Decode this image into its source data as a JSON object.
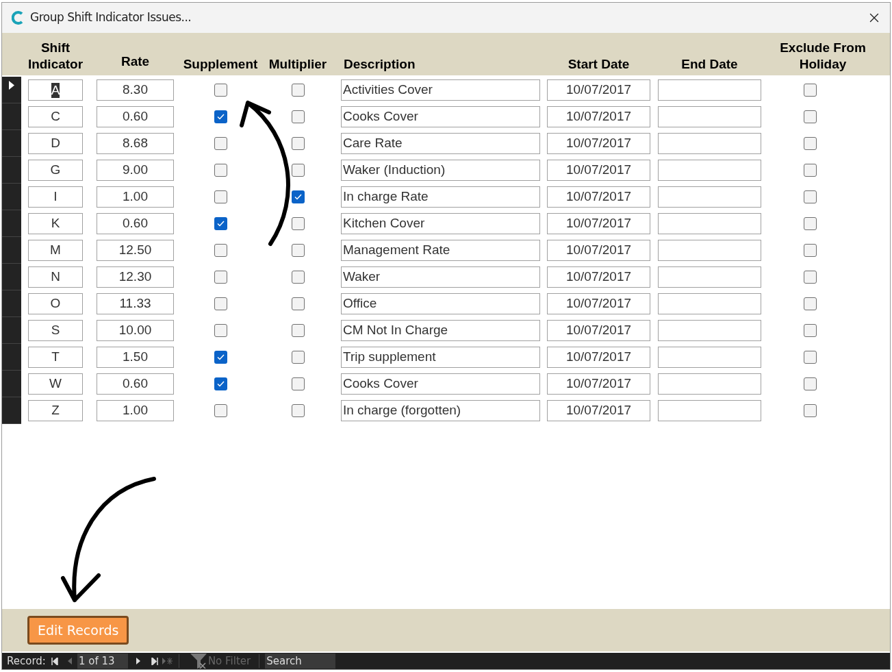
{
  "window": {
    "title": "Group Shift Indicator Issues..."
  },
  "columns": [
    "Shift Indicator",
    "Rate",
    "Supplement",
    "Multiplier",
    "Description",
    "Start Date",
    "End Date",
    "Exclude From Holiday"
  ],
  "rows": [
    {
      "shift_indicator": "A",
      "rate": "8.30",
      "supplement": false,
      "multiplier": false,
      "description": "Activities Cover",
      "start_date": "10/07/2017",
      "exclude_from_holiday": false,
      "selected": true
    },
    {
      "shift_indicator": "C",
      "rate": "0.60",
      "supplement": true,
      "multiplier": false,
      "description": "Cooks Cover",
      "start_date": "10/07/2017",
      "exclude_from_holiday": false,
      "selected": false
    },
    {
      "shift_indicator": "D",
      "rate": "8.68",
      "supplement": false,
      "multiplier": false,
      "description": "Care Rate",
      "start_date": "10/07/2017",
      "exclude_from_holiday": false,
      "selected": false
    },
    {
      "shift_indicator": "G",
      "rate": "9.00",
      "supplement": false,
      "multiplier": false,
      "description": "Waker (Induction)",
      "start_date": "10/07/2017",
      "exclude_from_holiday": false,
      "selected": false
    },
    {
      "shift_indicator": "I",
      "rate": "1.00",
      "supplement": false,
      "multiplier": true,
      "description": "In charge Rate",
      "start_date": "10/07/2017",
      "exclude_from_holiday": false,
      "selected": false
    },
    {
      "shift_indicator": "K",
      "rate": "0.60",
      "supplement": true,
      "multiplier": false,
      "description": "Kitchen Cover",
      "start_date": "10/07/2017",
      "exclude_from_holiday": false,
      "selected": false
    },
    {
      "shift_indicator": "M",
      "rate": "12.50",
      "supplement": false,
      "multiplier": false,
      "description": "Management Rate",
      "start_date": "10/07/2017",
      "exclude_from_holiday": false,
      "selected": false
    },
    {
      "shift_indicator": "N",
      "rate": "12.30",
      "supplement": false,
      "multiplier": false,
      "description": "Waker",
      "start_date": "10/07/2017",
      "exclude_from_holiday": false,
      "selected": false
    },
    {
      "shift_indicator": "O",
      "rate": "11.33",
      "supplement": false,
      "multiplier": false,
      "description": "Office",
      "start_date": "10/07/2017",
      "exclude_from_holiday": false,
      "selected": false
    },
    {
      "shift_indicator": "S",
      "rate": "10.00",
      "supplement": false,
      "multiplier": false,
      "description": "CM Not In Charge",
      "start_date": "10/07/2017",
      "exclude_from_holiday": false,
      "selected": false
    },
    {
      "shift_indicator": "T",
      "rate": "1.50",
      "supplement": true,
      "multiplier": false,
      "description": "Trip supplement",
      "start_date": "10/07/2017",
      "exclude_from_holiday": false,
      "selected": false
    },
    {
      "shift_indicator": "W",
      "rate": "0.60",
      "supplement": true,
      "multiplier": false,
      "description": "Cooks Cover",
      "start_date": "10/07/2017",
      "exclude_from_holiday": false,
      "selected": false
    },
    {
      "shift_indicator": "Z",
      "rate": "1.00",
      "supplement": false,
      "multiplier": false,
      "description": "In charge (forgotten)",
      "start_date": "10/07/2017",
      "exclude_from_holiday": false,
      "selected": false
    }
  ],
  "footer": {
    "button": "Edit Records"
  },
  "status_bar": {
    "label": "Record:",
    "position": "1 of 13",
    "filter": "No Filter",
    "search_placeholder": "Search"
  }
}
